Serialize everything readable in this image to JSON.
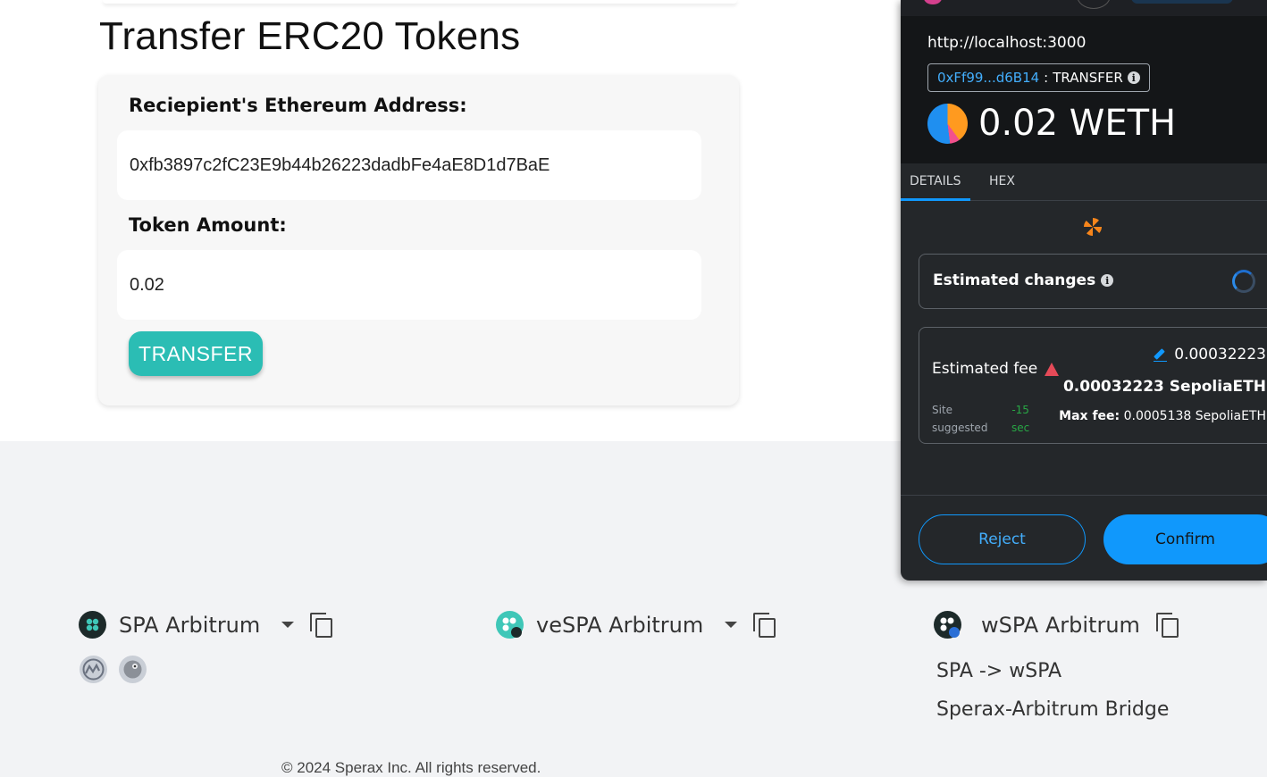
{
  "page": {
    "title": "Transfer ERC20 Tokens",
    "recipient_label": "Reciepient's Ethereum Address:",
    "recipient_value": "0xfb3897c2fC23E9b44b26223dadbFe4aE8D1d7BaE",
    "amount_label": "Token Amount:",
    "amount_value": "0.02",
    "transfer_button": "TRANSFER"
  },
  "footer": {
    "tokens": [
      {
        "label": "SPA Arbitrum",
        "has_dropdown": true
      },
      {
        "label": "veSPA Arbitrum",
        "has_dropdown": true
      },
      {
        "label": "wSPA Arbitrum",
        "has_dropdown": false
      }
    ],
    "links": [
      "SPA -> wSPA",
      "Sperax-Arbitrum Bridge"
    ],
    "icons": [
      "coinmarketcap-icon",
      "coingecko-icon"
    ],
    "copyright": "© 2024 Sperax Inc. All rights reserved."
  },
  "metamask": {
    "origin": "http://localhost:3000",
    "contract_address": "0xFf99...d6B14",
    "method_sep": ":",
    "method": "TRANSFER",
    "amount": "0.02 WETH",
    "tabs": [
      "DETAILS",
      "HEX"
    ],
    "active_tab": "DETAILS",
    "estimated_changes_label": "Estimated changes",
    "estimated_fee_label": "Estimated fee",
    "fee_primary": "0.00032223",
    "fee_native": "0.00032223 SepoliaETH",
    "site_suggested": "Site suggested",
    "time_value": "-15",
    "time_unit": "sec",
    "max_fee_label": "Max fee:",
    "max_fee_value": "0.0005138 SepoliaETH",
    "reject_label": "Reject",
    "confirm_label": "Confirm"
  },
  "colors": {
    "transfer_button": "#2bbdb4",
    "metamask_blue": "#1098fc",
    "warning_red": "#e54a58",
    "success_green": "#28a745"
  }
}
